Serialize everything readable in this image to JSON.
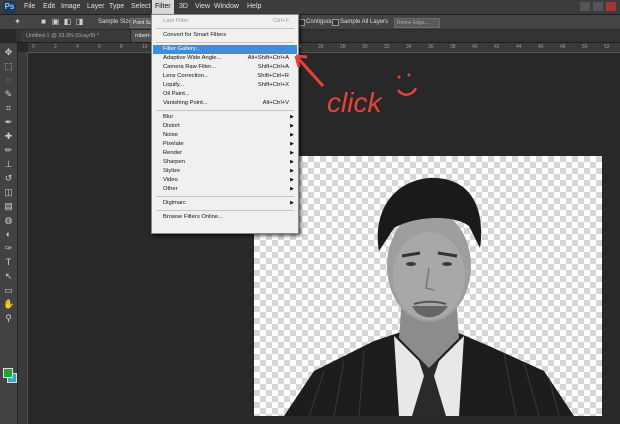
{
  "app": {
    "logo": "Ps"
  },
  "menubar": {
    "items": [
      "File",
      "Edit",
      "Image",
      "Layer",
      "Type",
      "Select",
      "Filter",
      "3D",
      "View",
      "Window",
      "Help"
    ],
    "active": "Filter"
  },
  "options_bar": {
    "sample_size_label": "Sample Size:",
    "sample_size_value": "Point Sa",
    "contiguous_label": "Contiguous",
    "sample_all_layers_label": "Sample All Layers",
    "refine_edge_label": "Refine Edge..."
  },
  "tabs": [
    {
      "label": "Untitled-1 @ 33.3% (Gray/8) *",
      "active": false
    },
    {
      "label": "robert-dow",
      "active": true
    }
  ],
  "ruler_ticks": [
    "0",
    "2",
    "4",
    "6",
    "8",
    "10",
    "12",
    "14",
    "16",
    "18",
    "20",
    "22",
    "24",
    "26",
    "28",
    "30",
    "32",
    "34",
    "36",
    "38",
    "40",
    "42",
    "44",
    "46",
    "48",
    "50",
    "52"
  ],
  "filter_menu": {
    "items": [
      {
        "label": "Last Filter",
        "shortcut": "Ctrl+F",
        "disabled": true
      },
      {
        "sep": true
      },
      {
        "label": "Convert for Smart Filters"
      },
      {
        "sep": true
      },
      {
        "label": "Filter Gallery...",
        "highlighted": true
      },
      {
        "label": "Adaptive Wide Angle...",
        "shortcut": "Alt+Shift+Ctrl+A"
      },
      {
        "label": "Camera Raw Filter...",
        "shortcut": "Shift+Ctrl+A"
      },
      {
        "label": "Lens Correction...",
        "shortcut": "Shift+Ctrl+R"
      },
      {
        "label": "Liquify...",
        "shortcut": "Shift+Ctrl+X"
      },
      {
        "label": "Oil Paint..."
      },
      {
        "label": "Vanishing Point...",
        "shortcut": "Alt+Ctrl+V"
      },
      {
        "sep": true
      },
      {
        "label": "Blur",
        "submenu": true
      },
      {
        "label": "Distort",
        "submenu": true
      },
      {
        "label": "Noise",
        "submenu": true
      },
      {
        "label": "Pixelate",
        "submenu": true
      },
      {
        "label": "Render",
        "submenu": true
      },
      {
        "label": "Sharpen",
        "submenu": true
      },
      {
        "label": "Stylize",
        "submenu": true
      },
      {
        "label": "Video",
        "submenu": true
      },
      {
        "label": "Other",
        "submenu": true
      },
      {
        "sep": true
      },
      {
        "label": "Digimarc",
        "submenu": true
      },
      {
        "sep": true
      },
      {
        "label": "Browse Filters Online..."
      }
    ]
  },
  "annotation": {
    "text": "click",
    "color": "#e8413a"
  },
  "tool_icons": [
    "move-icon",
    "marquee-icon",
    "lasso-icon",
    "quick-select-icon",
    "crop-icon",
    "eyedropper-icon",
    "healing-icon",
    "brush-icon",
    "stamp-icon",
    "history-brush-icon",
    "eraser-icon",
    "gradient-icon",
    "blur-icon",
    "dodge-icon",
    "pen-icon",
    "type-icon",
    "path-select-icon",
    "shape-icon",
    "hand-icon",
    "zoom-icon"
  ],
  "colors": {
    "foreground": "#1fa23a",
    "background": "#3aa6c2",
    "highlight": "#3b8ee0"
  }
}
